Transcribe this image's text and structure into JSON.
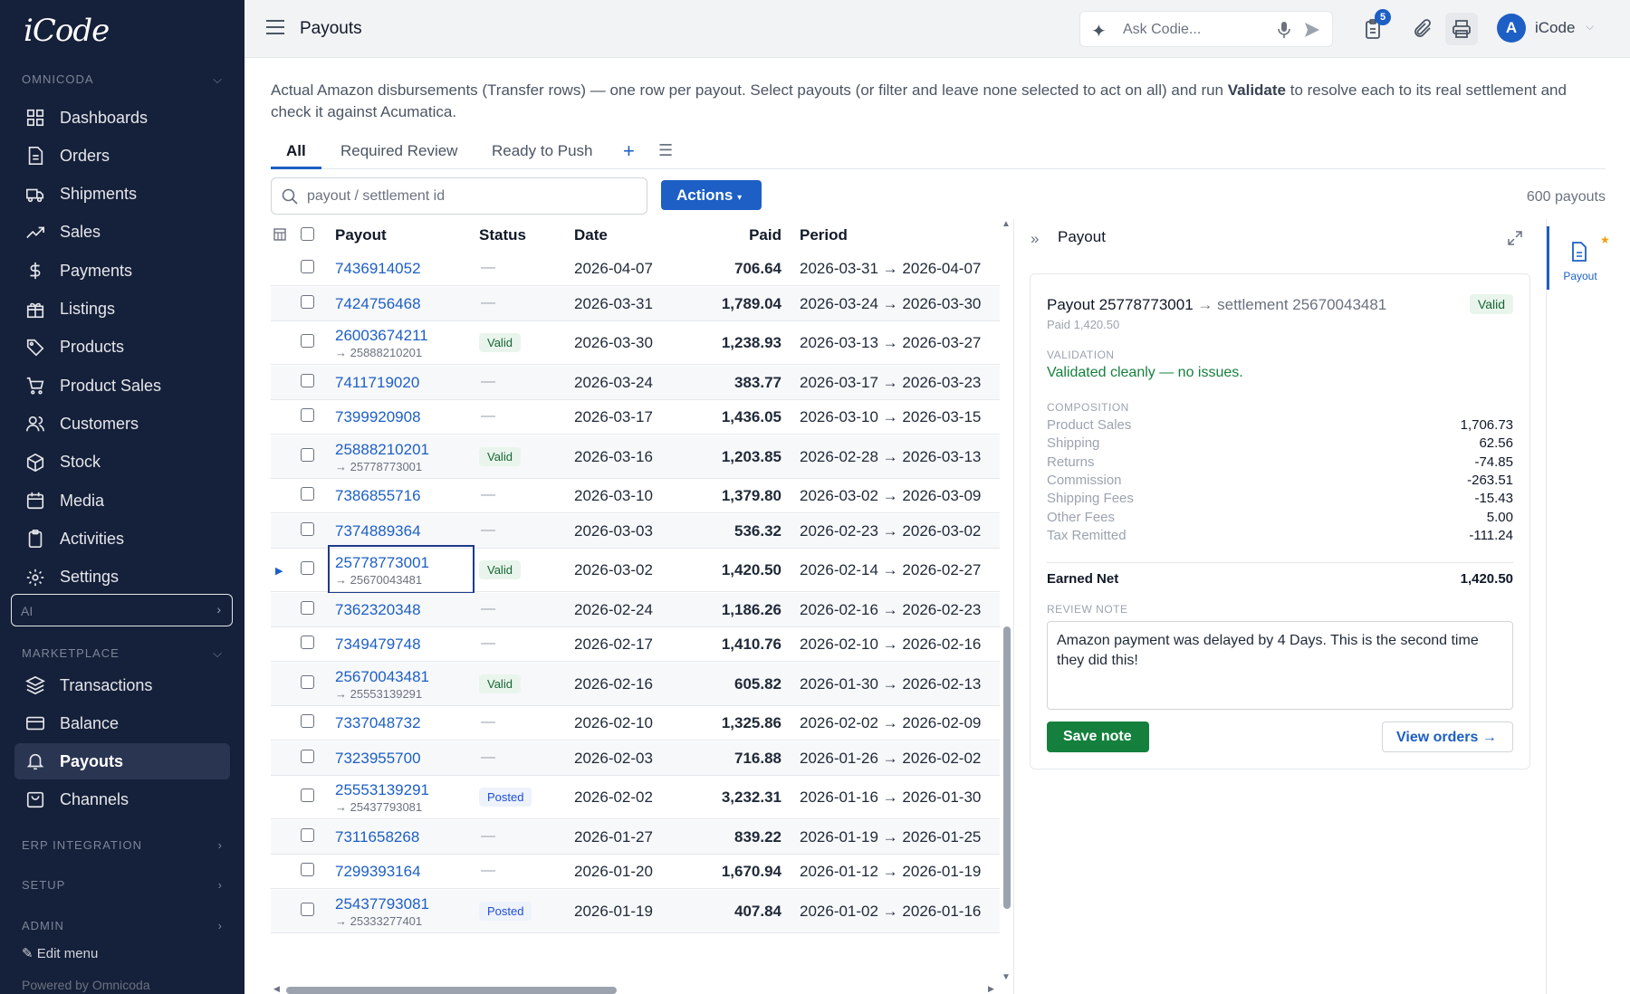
{
  "app": {
    "logo": "iCode"
  },
  "sidebar": {
    "section_omnicoda": "OMNICODA",
    "items_omnicoda": [
      {
        "label": "Dashboards",
        "icon": "grid-icon"
      },
      {
        "label": "Orders",
        "icon": "file-icon"
      },
      {
        "label": "Shipments",
        "icon": "truck-icon"
      },
      {
        "label": "Sales",
        "icon": "trend-icon"
      },
      {
        "label": "Payments",
        "icon": "dollar-icon"
      },
      {
        "label": "Listings",
        "icon": "gift-icon"
      },
      {
        "label": "Products",
        "icon": "tag-icon"
      },
      {
        "label": "Product Sales",
        "icon": "cart-icon"
      },
      {
        "label": "Customers",
        "icon": "users-icon"
      },
      {
        "label": "Stock",
        "icon": "box-icon"
      },
      {
        "label": "Media",
        "icon": "calendar-icon"
      },
      {
        "label": "Activities",
        "icon": "clipboard-icon"
      },
      {
        "label": "Settings",
        "icon": "gear-icon"
      }
    ],
    "ai_label": "AI",
    "section_marketplace": "MARKETPLACE",
    "items_marketplace": [
      {
        "label": "Transactions",
        "icon": "layers-icon"
      },
      {
        "label": "Balance",
        "icon": "card-icon"
      },
      {
        "label": "Payouts",
        "icon": "bell-icon",
        "active": true
      },
      {
        "label": "Channels",
        "icon": "bag-icon"
      }
    ],
    "section_erp": "ERP INTEGRATION",
    "section_setup": "SETUP",
    "section_admin": "ADMIN",
    "edit_menu": "Edit menu",
    "powered_by": "Powered by Omnicoda"
  },
  "topbar": {
    "title": "Payouts",
    "ask_placeholder": "Ask Codie...",
    "notification_count": "5",
    "avatar_letter": "A",
    "user_name": "iCode"
  },
  "description": {
    "part1": "Actual Amazon disbursements (Transfer rows) — one row per payout. Select payouts (or filter and leave none selected to act on all) and run ",
    "bold": "Validate",
    "part2": " to resolve each to its real settlement and check it against Acumatica."
  },
  "tabs": [
    "All",
    "Required Review",
    "Ready to Push"
  ],
  "search": {
    "placeholder": "payout / settlement id"
  },
  "actions_label": "Actions",
  "payout_count": "600 payouts",
  "table": {
    "headers": {
      "payout": "Payout",
      "status": "Status",
      "date": "Date",
      "paid": "Paid",
      "period": "Period"
    },
    "rows": [
      {
        "id": "7436914052",
        "sub": "",
        "status": "—",
        "date": "2026-04-07",
        "paid": "706.64",
        "period": "2026-03-31 → 2026-04-07"
      },
      {
        "id": "7424756468",
        "sub": "",
        "status": "—",
        "date": "2026-03-31",
        "paid": "1,789.04",
        "period": "2026-03-24 → 2026-03-30"
      },
      {
        "id": "26003674211",
        "sub": "→ 25888210201",
        "status": "Valid",
        "date": "2026-03-30",
        "paid": "1,238.93",
        "period": "2026-03-13 → 2026-03-27"
      },
      {
        "id": "7411719020",
        "sub": "",
        "status": "—",
        "date": "2026-03-24",
        "paid": "383.77",
        "period": "2026-03-17 → 2026-03-23"
      },
      {
        "id": "7399920908",
        "sub": "",
        "status": "—",
        "date": "2026-03-17",
        "paid": "1,436.05",
        "period": "2026-03-10 → 2026-03-15"
      },
      {
        "id": "25888210201",
        "sub": "→ 25778773001",
        "status": "Valid",
        "date": "2026-03-16",
        "paid": "1,203.85",
        "period": "2026-02-28 → 2026-03-13"
      },
      {
        "id": "7386855716",
        "sub": "",
        "status": "—",
        "date": "2026-03-10",
        "paid": "1,379.80",
        "period": "2026-03-02 → 2026-03-09"
      },
      {
        "id": "7374889364",
        "sub": "",
        "status": "—",
        "date": "2026-03-03",
        "paid": "536.32",
        "period": "2026-02-23 → 2026-03-02"
      },
      {
        "id": "25778773001",
        "sub": "→ 25670043481",
        "status": "Valid",
        "date": "2026-03-02",
        "paid": "1,420.50",
        "period": "2026-02-14 → 2026-02-27",
        "selected": true
      },
      {
        "id": "7362320348",
        "sub": "",
        "status": "—",
        "date": "2026-02-24",
        "paid": "1,186.26",
        "period": "2026-02-16 → 2026-02-23"
      },
      {
        "id": "7349479748",
        "sub": "",
        "status": "—",
        "date": "2026-02-17",
        "paid": "1,410.76",
        "period": "2026-02-10 → 2026-02-16"
      },
      {
        "id": "25670043481",
        "sub": "→ 25553139291",
        "status": "Valid",
        "date": "2026-02-16",
        "paid": "605.82",
        "period": "2026-01-30 → 2026-02-13"
      },
      {
        "id": "7337048732",
        "sub": "",
        "status": "—",
        "date": "2026-02-10",
        "paid": "1,325.86",
        "period": "2026-02-02 → 2026-02-09"
      },
      {
        "id": "7323955700",
        "sub": "",
        "status": "—",
        "date": "2026-02-03",
        "paid": "716.88",
        "period": "2026-01-26 → 2026-02-02"
      },
      {
        "id": "25553139291",
        "sub": "→ 25437793081",
        "status": "Posted",
        "date": "2026-02-02",
        "paid": "3,232.31",
        "period": "2026-01-16 → 2026-01-30"
      },
      {
        "id": "7311658268",
        "sub": "",
        "status": "—",
        "date": "2026-01-27",
        "paid": "839.22",
        "period": "2026-01-19 → 2026-01-25"
      },
      {
        "id": "7299393164",
        "sub": "",
        "status": "—",
        "date": "2026-01-20",
        "paid": "1,670.94",
        "period": "2026-01-12 → 2026-01-19"
      },
      {
        "id": "25437793081",
        "sub": "→ 25333277401",
        "status": "Posted",
        "date": "2026-01-19",
        "paid": "407.84",
        "period": "2026-01-02 → 2026-01-16"
      }
    ]
  },
  "panel": {
    "header": "Payout",
    "title_payout": "Payout 25778773001",
    "title_settlement": "→ settlement 25670043481",
    "paid_line": "Paid 1,420.50",
    "badge": "Valid",
    "validation_label": "VALIDATION",
    "validation_text": "Validated cleanly — no issues.",
    "composition_label": "COMPOSITION",
    "composition": [
      {
        "label": "Product Sales",
        "value": "1,706.73"
      },
      {
        "label": "Shipping",
        "value": "62.56"
      },
      {
        "label": "Returns",
        "value": "-74.85"
      },
      {
        "label": "Commission",
        "value": "-263.51"
      },
      {
        "label": "Shipping Fees",
        "value": "-15.43"
      },
      {
        "label": "Other Fees",
        "value": "5.00"
      },
      {
        "label": "Tax Remitted",
        "value": "-111.24"
      }
    ],
    "earned_label": "Earned Net",
    "earned_value": "1,420.50",
    "review_label": "REVIEW NOTE",
    "review_note": "Amazon payment was delayed by 4 Days.  This is the second time they did this!",
    "save_label": "Save note",
    "view_label": "View orders →",
    "rail_label": "Payout"
  },
  "colors": {
    "sidebar_bg": "#15203a",
    "accent": "#1d5fc4",
    "valid_green": "#15803d"
  }
}
